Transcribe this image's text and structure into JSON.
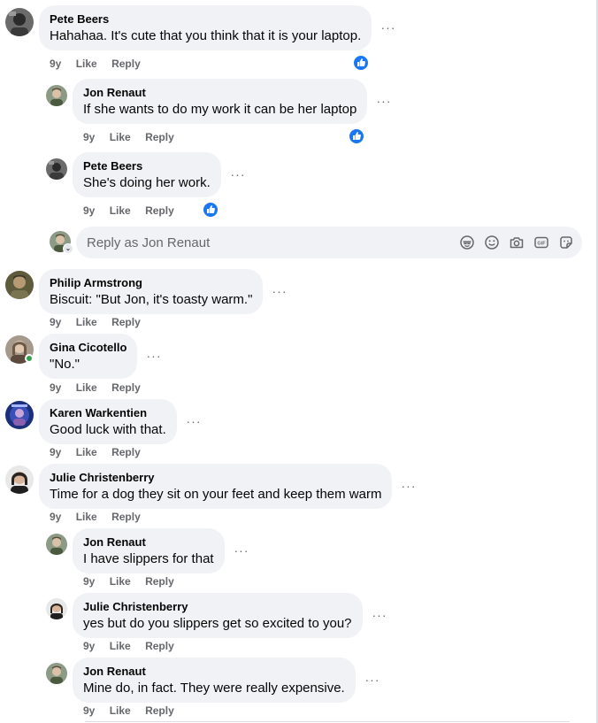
{
  "comments": [
    {
      "author": "Pete Beers",
      "text": "Hahahaa. It's cute that you think that it is your laptop.",
      "age": "9y",
      "like": "Like",
      "reply": "Reply",
      "more": "···",
      "reacted": true
    },
    {
      "author": "Jon Renaut",
      "text": "If she wants to do my work it can be her laptop",
      "age": "9y",
      "like": "Like",
      "reply": "Reply",
      "more": "···",
      "reacted": true
    },
    {
      "author": "Pete Beers",
      "text": "She's doing her work.",
      "age": "9y",
      "like": "Like",
      "reply": "Reply",
      "more": "···",
      "reacted": true
    },
    {
      "author": "Philip Armstrong",
      "text": "Biscuit: \"But Jon, it's toasty warm.\"",
      "age": "9y",
      "like": "Like",
      "reply": "Reply",
      "more": "···",
      "reacted": false
    },
    {
      "author": "Gina Cicotello",
      "text": "\"No.\"",
      "age": "9y",
      "like": "Like",
      "reply": "Reply",
      "more": "···",
      "reacted": false,
      "online": true
    },
    {
      "author": "Karen Warkentien",
      "text": "Good luck with that.",
      "age": "9y",
      "like": "Like",
      "reply": "Reply",
      "more": "···",
      "reacted": false
    },
    {
      "author": "Julie Christenberry",
      "text": "Time for a dog they sit on your feet and keep them warm",
      "age": "9y",
      "like": "Like",
      "reply": "Reply",
      "more": "···",
      "reacted": false
    },
    {
      "author": "Jon Renaut",
      "text": "I have slippers for that",
      "age": "9y",
      "like": "Like",
      "reply": "Reply",
      "more": "···",
      "reacted": false
    },
    {
      "author": "Julie Christenberry",
      "text": "yes but do you slippers get so excited to you?",
      "age": "9y",
      "like": "Like",
      "reply": "Reply",
      "more": "···",
      "reacted": false
    },
    {
      "author": "Jon Renaut",
      "text": "Mine do, in fact. They were really expensive.",
      "age": "9y",
      "like": "Like",
      "reply": "Reply",
      "more": "···",
      "reacted": false
    }
  ],
  "reply_box": {
    "placeholder": "Reply as Jon Renaut",
    "tools": [
      "avatar-sticker-icon",
      "emoji-icon",
      "camera-icon",
      "gif-icon",
      "sticker-icon"
    ]
  },
  "colors": {
    "bubble": "#f0f2f5",
    "secondary_text": "#65676b",
    "like_blue": "#1877f2",
    "online_green": "#31a24c"
  }
}
